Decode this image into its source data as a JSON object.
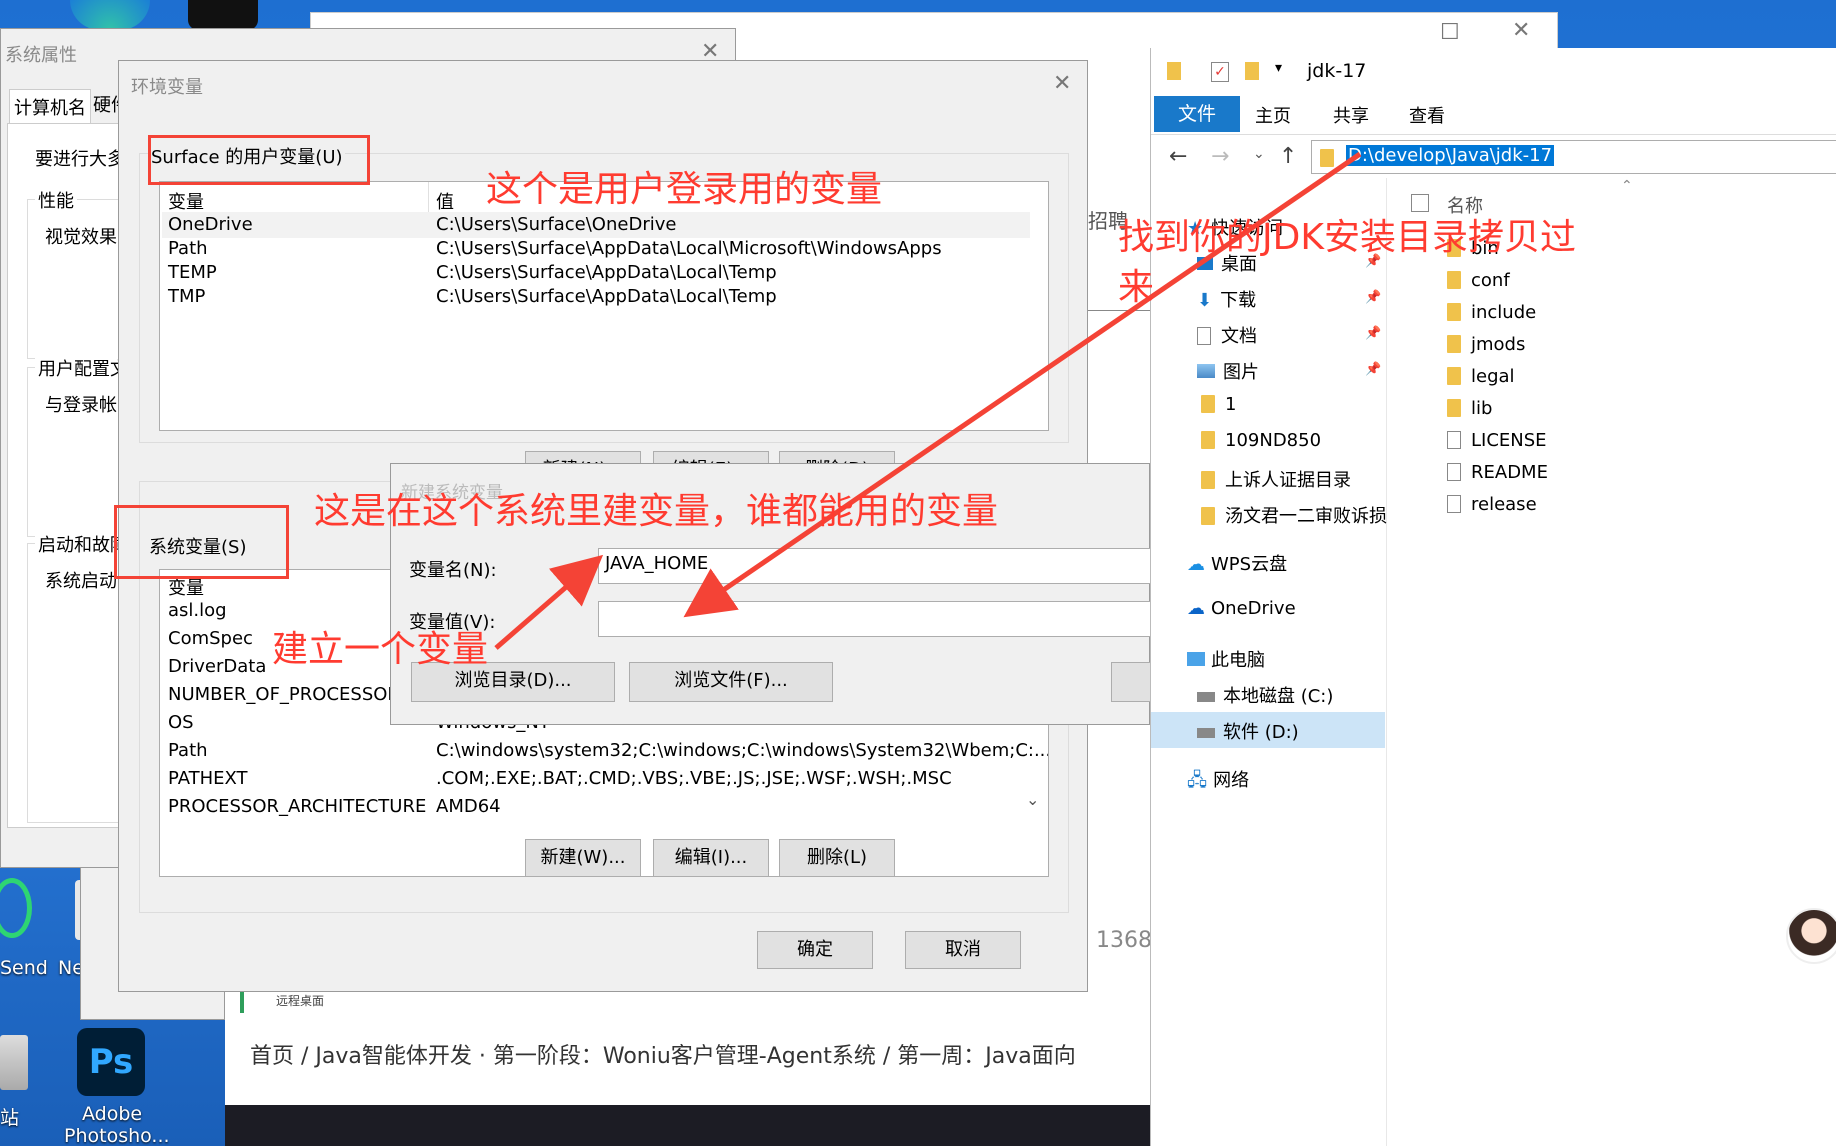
{
  "desktop": {
    "icons": [
      {
        "label": "Send"
      },
      {
        "label": "Ne"
      },
      {
        "label": "站"
      },
      {
        "label": "Adobe"
      },
      {
        "label": "Photosho..."
      }
    ]
  },
  "webpage": {
    "breadcrumb": "首页 / Java智能体开发 · 第一阶段：Woniu客户管理-Agent系统 / 第一周：Java面向",
    "remote_label": "远程桌面",
    "number": "1368",
    "side_text": "招聘"
  },
  "sys_props": {
    "title": "系统属性",
    "tabs": [
      "计算机名",
      "硬件"
    ],
    "intro": "要进行大多",
    "groups": [
      {
        "label": "性能",
        "desc": "视觉效果"
      },
      {
        "label": "用户配置文",
        "desc": "与登录帐"
      },
      {
        "label": "启动和故障",
        "desc": "系统启动"
      }
    ]
  },
  "env_vars": {
    "title": "环境变量",
    "user_group": "Surface 的用户变量(U)",
    "col_var": "变量",
    "col_val": "值",
    "user_vars": [
      {
        "name": "OneDrive",
        "value": "C:\\Users\\Surface\\OneDrive"
      },
      {
        "name": "Path",
        "value": "C:\\Users\\Surface\\AppData\\Local\\Microsoft\\WindowsApps"
      },
      {
        "name": "TEMP",
        "value": "C:\\Users\\Surface\\AppData\\Local\\Temp"
      },
      {
        "name": "TMP",
        "value": "C:\\Users\\Surface\\AppData\\Local\\Temp"
      }
    ],
    "user_buttons": [
      "新建(N)...",
      "编辑(E)...",
      "删除(D)"
    ],
    "sys_group": "系统变量(S)",
    "sys_col_var": "变量",
    "sys_vars": [
      {
        "name": "asl.log",
        "value": ""
      },
      {
        "name": "ComSpec",
        "value": ""
      },
      {
        "name": "DriverData",
        "value": ""
      },
      {
        "name": "NUMBER_OF_PROCESSORS",
        "value": ""
      },
      {
        "name": "OS",
        "value": "Windows_NT"
      },
      {
        "name": "Path",
        "value": "C:\\windows\\system32;C:\\windows;C:\\windows\\System32\\Wbem;C:..."
      },
      {
        "name": "PATHEXT",
        "value": ".COM;.EXE;.BAT;.CMD;.VBS;.VBE;.JS;.JSE;.WSF;.WSH;.MSC"
      },
      {
        "name": "PROCESSOR_ARCHITECTURE",
        "value": "AMD64"
      }
    ],
    "sys_buttons": [
      "新建(W)...",
      "编辑(I)...",
      "删除(L)"
    ],
    "ok": "确定",
    "cancel": "取消"
  },
  "new_var": {
    "title": "新建系统变量",
    "name_label": "变量名(N):",
    "name_value": "JAVA_HOME",
    "value_label": "变量值(V):",
    "value_value": "",
    "browse_dir": "浏览目录(D)...",
    "browse_file": "浏览文件(F)..."
  },
  "annotations": {
    "user_note": "这个是用户登录用的变量",
    "sys_note": "这是在这个系统里建变量，谁都能用的变量",
    "create_note": "建立一个变量",
    "copy_note_1": "找到你的JDK安装目录拷贝过",
    "copy_note_2": "来"
  },
  "explorer": {
    "title": "jdk-17",
    "tabs": [
      "文件",
      "主页",
      "共享",
      "查看"
    ],
    "address": "D:\\develop\\Java\\jdk-17",
    "col_name": "名称",
    "quick_access": "快速访问",
    "nav": [
      {
        "label": "桌面",
        "pinned": true
      },
      {
        "label": "下载",
        "pinned": true
      },
      {
        "label": "文档",
        "pinned": true
      },
      {
        "label": "图片",
        "pinned": true
      },
      {
        "label": "1",
        "pinned": false
      },
      {
        "label": "109ND850",
        "pinned": false
      },
      {
        "label": "上诉人证据目录",
        "pinned": false
      },
      {
        "label": "汤文君一二审败诉损",
        "pinned": false
      }
    ],
    "wps": "WPS云盘",
    "onedrive": "OneDrive",
    "this_pc": "此电脑",
    "drive_c": "本地磁盘 (C:)",
    "drive_d": "软件 (D:)",
    "network": "网络",
    "files": [
      {
        "name": "bin",
        "type": "folder"
      },
      {
        "name": "conf",
        "type": "folder"
      },
      {
        "name": "include",
        "type": "folder"
      },
      {
        "name": "jmods",
        "type": "folder"
      },
      {
        "name": "legal",
        "type": "folder"
      },
      {
        "name": "lib",
        "type": "folder"
      },
      {
        "name": "LICENSE",
        "type": "file"
      },
      {
        "name": "README",
        "type": "file"
      },
      {
        "name": "release",
        "type": "file"
      }
    ]
  }
}
